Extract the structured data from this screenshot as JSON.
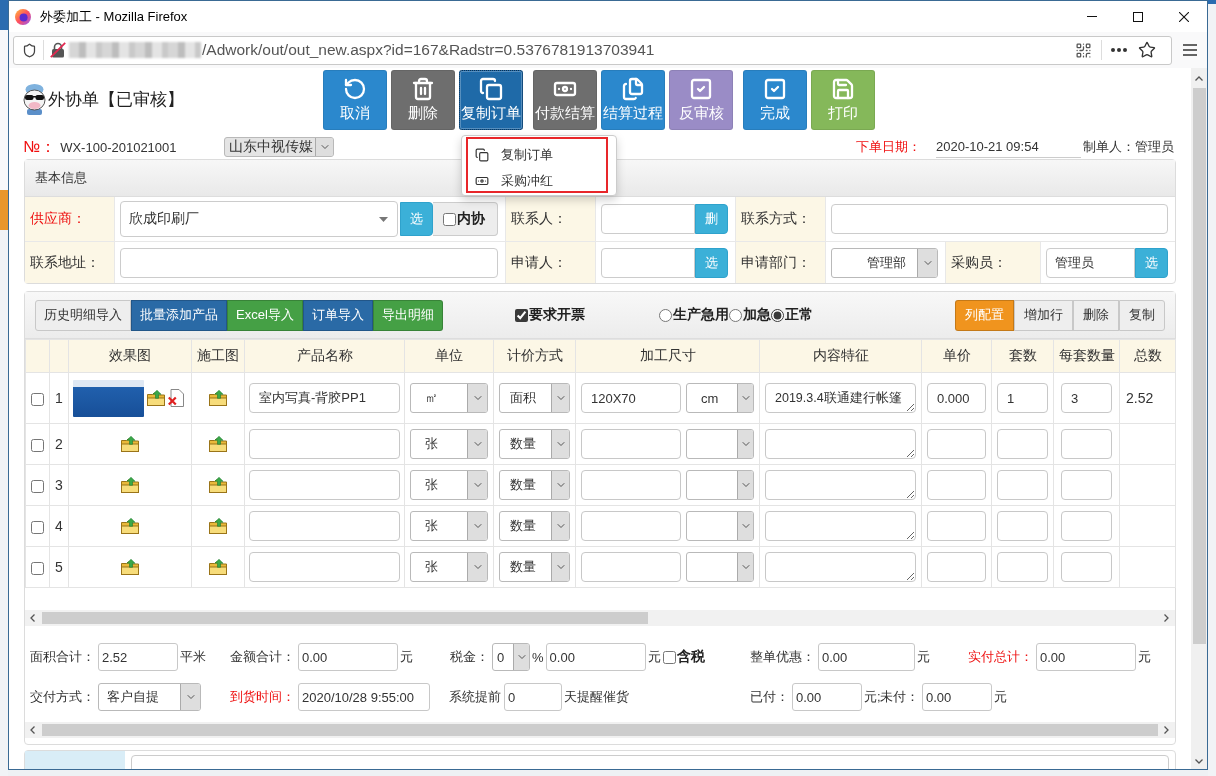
{
  "window": {
    "title": "外委加工 - Mozilla Firefox"
  },
  "address_bar": {
    "url": "/Adwork/out/out_new.aspx?id=167&Radstr=0.5376781913703941"
  },
  "header": {
    "title": "外协单【已审核】"
  },
  "toolbar": [
    [
      {
        "label": "取消",
        "kind": "undo",
        "color": "#2b88cd",
        "expanded": false
      },
      {
        "label": "删除",
        "kind": "trash",
        "color": "#6e6e6e",
        "expanded": false
      },
      {
        "label": "复制订单",
        "kind": "copy",
        "color": "#1f6aa8",
        "expanded": true,
        "menu": {
          "highlighted": true,
          "items": [
            {
              "label": "复制订单",
              "kind": "copy"
            },
            {
              "label": "采购冲红",
              "kind": "money"
            }
          ]
        }
      }
    ],
    [
      {
        "label": "付款结算",
        "kind": "money",
        "color": "#6e6e6e",
        "expanded": false
      },
      {
        "label": "结算过程",
        "kind": "document",
        "color": "#2b88cd",
        "expanded": false
      },
      {
        "label": "反审核",
        "kind": "check",
        "color": "#9a8cc6",
        "expanded": false
      }
    ],
    [
      {
        "label": "完成",
        "kind": "check",
        "color": "#2b88cd",
        "expanded": false
      },
      {
        "label": "打印",
        "kind": "save",
        "color": "#85b85a",
        "expanded": false
      }
    ]
  ],
  "order": {
    "number_label": "№：",
    "number": "WX-100-201021001",
    "company": {
      "value": "山东中视传媒",
      "disabled": true
    },
    "date_label": "下单日期：",
    "date": "2020-10-21 09:54",
    "creator": "制单人：管理员"
  },
  "basic_info": {
    "title": "基本信息",
    "rows": [
      [
        {
          "label": "供应商：",
          "required": true,
          "kind": "combo",
          "value": "欣成印刷厂",
          "button": "选",
          "checkbox": {
            "label": "内协",
            "checked": false
          }
        },
        {
          "label": "联系人：",
          "required": false,
          "kind": "input",
          "button": "删"
        },
        {
          "label": "联系方式：",
          "required": false,
          "kind": "input"
        }
      ],
      [
        {
          "label": "联系地址：",
          "required": false,
          "kind": "input"
        },
        {
          "label": "申请人：",
          "required": false,
          "kind": "input",
          "button": "选"
        },
        {
          "label": "申请部门：",
          "required": false,
          "kind": "select",
          "value": "管理部"
        },
        {
          "label": "采购员：",
          "required": false,
          "kind": "input",
          "value": "管理员",
          "button": "选"
        }
      ]
    ]
  },
  "items": {
    "buttons": [
      {
        "label": "历史明细导入",
        "color": "#eeeeee"
      },
      {
        "label": "批量添加产品",
        "color": "#2a6aa6"
      },
      {
        "label": "Excel导入",
        "color": "#45a045"
      },
      {
        "label": "订单导入",
        "color": "#2a6aa6"
      },
      {
        "label": "导出明细",
        "color": "#45a045"
      }
    ],
    "invoice": {
      "label": "要求开票",
      "checked": true
    },
    "priority": [
      {
        "label": "生产急用",
        "selected": false
      },
      {
        "label": "加急",
        "selected": false
      },
      {
        "label": "正常",
        "selected": true
      }
    ],
    "actions": [
      {
        "label": "列配置",
        "color": "#f0941e"
      },
      {
        "label": "增加行",
        "color": "#eeeeee"
      },
      {
        "label": "删除",
        "color": "#eeeeee"
      },
      {
        "label": "复制",
        "color": "#eeeeee"
      }
    ],
    "table": {
      "columns": [
        "效果图",
        "施工图",
        "产品名称",
        "单位",
        "计价方式",
        "加工尺寸",
        "内容特征",
        "单价",
        "套数",
        "每套数量",
        "总数"
      ],
      "rows": [
        {
          "checked": false,
          "number": "1",
          "has_image": true,
          "name": "室内写真-背胶PP1",
          "unit": "㎡",
          "pricing": "面积",
          "size": "120X70",
          "size_unit": "cm",
          "content": "2019.3.4联通建行帐篷",
          "price": "0.000",
          "sets": "1",
          "per_set": "3",
          "total": "2.52"
        },
        {
          "checked": false,
          "number": "2",
          "has_image": false,
          "unit": "张",
          "pricing": "数量"
        },
        {
          "checked": false,
          "number": "3",
          "has_image": false,
          "unit": "张",
          "pricing": "数量"
        },
        {
          "checked": false,
          "number": "4",
          "has_image": false,
          "unit": "张",
          "pricing": "数量"
        },
        {
          "checked": false,
          "number": "5",
          "has_image": false,
          "unit": "张",
          "pricing": "数量"
        }
      ]
    }
  },
  "summary": [
    [
      {
        "kind": "input",
        "label": "面积合计：",
        "required": false,
        "value": "2.52",
        "suffix": "平米"
      },
      {
        "kind": "input",
        "label": "金额合计：",
        "required": false,
        "value": "0.00",
        "suffix": "元"
      },
      {
        "kind": "tax",
        "label": "税金：",
        "required": false,
        "rate": "0",
        "rate_suffix": "%",
        "value": "0.00",
        "suffix": "元",
        "checkbox": {
          "label": "含税",
          "checked": false
        }
      },
      {
        "kind": "input",
        "label": "整单优惠：",
        "required": false,
        "value": "0.00",
        "suffix": "元"
      },
      {
        "kind": "input",
        "label": "实付总计：",
        "required": true,
        "value": "0.00",
        "suffix": "元"
      }
    ],
    [
      {
        "kind": "select",
        "label": "交付方式：",
        "required": false,
        "value": "客户自提"
      },
      {
        "kind": "input",
        "label": "到货时间：",
        "required": true,
        "value": "2020/10/28 9:55:00"
      },
      {
        "kind": "input",
        "label": "系统提前",
        "required": false,
        "value": "0",
        "suffix": "天提醒催货"
      },
      {
        "kind": "input",
        "label": "已付：",
        "required": false,
        "value": "0.00",
        "suffix": "元;"
      },
      {
        "kind": "input",
        "label": "未付：",
        "required": false,
        "value": "0.00",
        "suffix": "元"
      }
    ]
  ]
}
